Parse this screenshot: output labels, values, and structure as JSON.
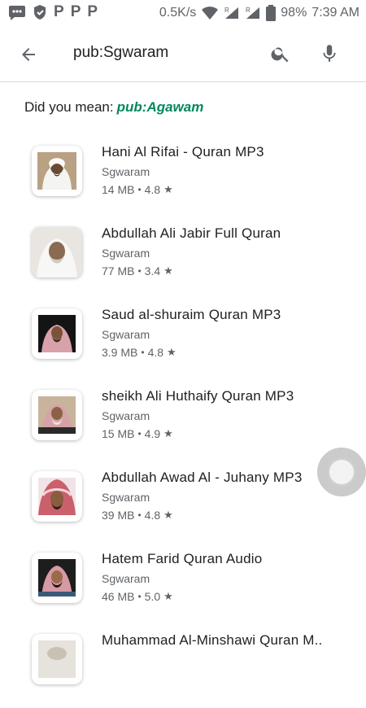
{
  "status_bar": {
    "net_speed": "0.5K/s",
    "battery": "98%",
    "time": "7:39 AM",
    "left_icons": [
      "chat-icon",
      "shield-icon",
      "p-icon",
      "p-icon",
      "p-icon"
    ],
    "right_icons": [
      "wifi-icon",
      "signal-icon",
      "signal-icon",
      "battery-icon"
    ],
    "roaming_mark": "R",
    "p_glyph": "P"
  },
  "search": {
    "query": "pub:Sgwaram"
  },
  "suggestion": {
    "prefix": "Did you mean:",
    "link": "pub:Agawam"
  },
  "apps": [
    {
      "title": "Hani Al Rifai - Quran MP3",
      "developer": "Sgwaram",
      "size": "14 MB",
      "rating": "4.8"
    },
    {
      "title": "Abdullah Ali Jabir Full Quran",
      "developer": "Sgwaram",
      "size": "77 MB",
      "rating": "3.4"
    },
    {
      "title": "Saud al-shuraim Quran MP3",
      "developer": "Sgwaram",
      "size": "3.9 MB",
      "rating": "4.8"
    },
    {
      "title": "sheikh Ali Huthaify Quran MP3",
      "developer": "Sgwaram",
      "size": "15 MB",
      "rating": "4.9"
    },
    {
      "title": "Abdullah Awad Al - Juhany MP3",
      "developer": "Sgwaram",
      "size": "39 MB",
      "rating": "4.8"
    },
    {
      "title": "Hatem Farid Quran Audio",
      "developer": "Sgwaram",
      "size": "46 MB",
      "rating": "5.0"
    },
    {
      "title": "Muhammad Al-Minshawi Quran M..",
      "developer": "",
      "size": "",
      "rating": ""
    }
  ],
  "separators": {
    "dot": "•",
    "star": "★"
  },
  "colors": {
    "link": "#01875f",
    "text": "#202124",
    "secondary": "#5f6368"
  }
}
